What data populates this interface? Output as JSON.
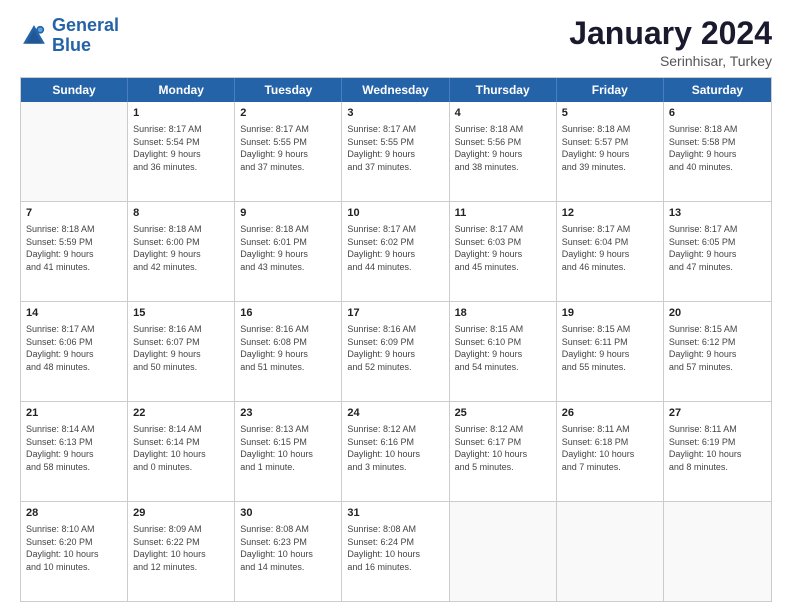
{
  "logo": {
    "text_general": "General",
    "text_blue": "Blue"
  },
  "header": {
    "month": "January 2024",
    "location": "Serinhisar, Turkey"
  },
  "weekdays": [
    "Sunday",
    "Monday",
    "Tuesday",
    "Wednesday",
    "Thursday",
    "Friday",
    "Saturday"
  ],
  "rows": [
    [
      {
        "day": "",
        "lines": []
      },
      {
        "day": "1",
        "lines": [
          "Sunrise: 8:17 AM",
          "Sunset: 5:54 PM",
          "Daylight: 9 hours",
          "and 36 minutes."
        ]
      },
      {
        "day": "2",
        "lines": [
          "Sunrise: 8:17 AM",
          "Sunset: 5:55 PM",
          "Daylight: 9 hours",
          "and 37 minutes."
        ]
      },
      {
        "day": "3",
        "lines": [
          "Sunrise: 8:17 AM",
          "Sunset: 5:55 PM",
          "Daylight: 9 hours",
          "and 37 minutes."
        ]
      },
      {
        "day": "4",
        "lines": [
          "Sunrise: 8:18 AM",
          "Sunset: 5:56 PM",
          "Daylight: 9 hours",
          "and 38 minutes."
        ]
      },
      {
        "day": "5",
        "lines": [
          "Sunrise: 8:18 AM",
          "Sunset: 5:57 PM",
          "Daylight: 9 hours",
          "and 39 minutes."
        ]
      },
      {
        "day": "6",
        "lines": [
          "Sunrise: 8:18 AM",
          "Sunset: 5:58 PM",
          "Daylight: 9 hours",
          "and 40 minutes."
        ]
      }
    ],
    [
      {
        "day": "7",
        "lines": [
          "Sunrise: 8:18 AM",
          "Sunset: 5:59 PM",
          "Daylight: 9 hours",
          "and 41 minutes."
        ]
      },
      {
        "day": "8",
        "lines": [
          "Sunrise: 8:18 AM",
          "Sunset: 6:00 PM",
          "Daylight: 9 hours",
          "and 42 minutes."
        ]
      },
      {
        "day": "9",
        "lines": [
          "Sunrise: 8:18 AM",
          "Sunset: 6:01 PM",
          "Daylight: 9 hours",
          "and 43 minutes."
        ]
      },
      {
        "day": "10",
        "lines": [
          "Sunrise: 8:17 AM",
          "Sunset: 6:02 PM",
          "Daylight: 9 hours",
          "and 44 minutes."
        ]
      },
      {
        "day": "11",
        "lines": [
          "Sunrise: 8:17 AM",
          "Sunset: 6:03 PM",
          "Daylight: 9 hours",
          "and 45 minutes."
        ]
      },
      {
        "day": "12",
        "lines": [
          "Sunrise: 8:17 AM",
          "Sunset: 6:04 PM",
          "Daylight: 9 hours",
          "and 46 minutes."
        ]
      },
      {
        "day": "13",
        "lines": [
          "Sunrise: 8:17 AM",
          "Sunset: 6:05 PM",
          "Daylight: 9 hours",
          "and 47 minutes."
        ]
      }
    ],
    [
      {
        "day": "14",
        "lines": [
          "Sunrise: 8:17 AM",
          "Sunset: 6:06 PM",
          "Daylight: 9 hours",
          "and 48 minutes."
        ]
      },
      {
        "day": "15",
        "lines": [
          "Sunrise: 8:16 AM",
          "Sunset: 6:07 PM",
          "Daylight: 9 hours",
          "and 50 minutes."
        ]
      },
      {
        "day": "16",
        "lines": [
          "Sunrise: 8:16 AM",
          "Sunset: 6:08 PM",
          "Daylight: 9 hours",
          "and 51 minutes."
        ]
      },
      {
        "day": "17",
        "lines": [
          "Sunrise: 8:16 AM",
          "Sunset: 6:09 PM",
          "Daylight: 9 hours",
          "and 52 minutes."
        ]
      },
      {
        "day": "18",
        "lines": [
          "Sunrise: 8:15 AM",
          "Sunset: 6:10 PM",
          "Daylight: 9 hours",
          "and 54 minutes."
        ]
      },
      {
        "day": "19",
        "lines": [
          "Sunrise: 8:15 AM",
          "Sunset: 6:11 PM",
          "Daylight: 9 hours",
          "and 55 minutes."
        ]
      },
      {
        "day": "20",
        "lines": [
          "Sunrise: 8:15 AM",
          "Sunset: 6:12 PM",
          "Daylight: 9 hours",
          "and 57 minutes."
        ]
      }
    ],
    [
      {
        "day": "21",
        "lines": [
          "Sunrise: 8:14 AM",
          "Sunset: 6:13 PM",
          "Daylight: 9 hours",
          "and 58 minutes."
        ]
      },
      {
        "day": "22",
        "lines": [
          "Sunrise: 8:14 AM",
          "Sunset: 6:14 PM",
          "Daylight: 10 hours",
          "and 0 minutes."
        ]
      },
      {
        "day": "23",
        "lines": [
          "Sunrise: 8:13 AM",
          "Sunset: 6:15 PM",
          "Daylight: 10 hours",
          "and 1 minute."
        ]
      },
      {
        "day": "24",
        "lines": [
          "Sunrise: 8:12 AM",
          "Sunset: 6:16 PM",
          "Daylight: 10 hours",
          "and 3 minutes."
        ]
      },
      {
        "day": "25",
        "lines": [
          "Sunrise: 8:12 AM",
          "Sunset: 6:17 PM",
          "Daylight: 10 hours",
          "and 5 minutes."
        ]
      },
      {
        "day": "26",
        "lines": [
          "Sunrise: 8:11 AM",
          "Sunset: 6:18 PM",
          "Daylight: 10 hours",
          "and 7 minutes."
        ]
      },
      {
        "day": "27",
        "lines": [
          "Sunrise: 8:11 AM",
          "Sunset: 6:19 PM",
          "Daylight: 10 hours",
          "and 8 minutes."
        ]
      }
    ],
    [
      {
        "day": "28",
        "lines": [
          "Sunrise: 8:10 AM",
          "Sunset: 6:20 PM",
          "Daylight: 10 hours",
          "and 10 minutes."
        ]
      },
      {
        "day": "29",
        "lines": [
          "Sunrise: 8:09 AM",
          "Sunset: 6:22 PM",
          "Daylight: 10 hours",
          "and 12 minutes."
        ]
      },
      {
        "day": "30",
        "lines": [
          "Sunrise: 8:08 AM",
          "Sunset: 6:23 PM",
          "Daylight: 10 hours",
          "and 14 minutes."
        ]
      },
      {
        "day": "31",
        "lines": [
          "Sunrise: 8:08 AM",
          "Sunset: 6:24 PM",
          "Daylight: 10 hours",
          "and 16 minutes."
        ]
      },
      {
        "day": "",
        "lines": []
      },
      {
        "day": "",
        "lines": []
      },
      {
        "day": "",
        "lines": []
      }
    ]
  ]
}
